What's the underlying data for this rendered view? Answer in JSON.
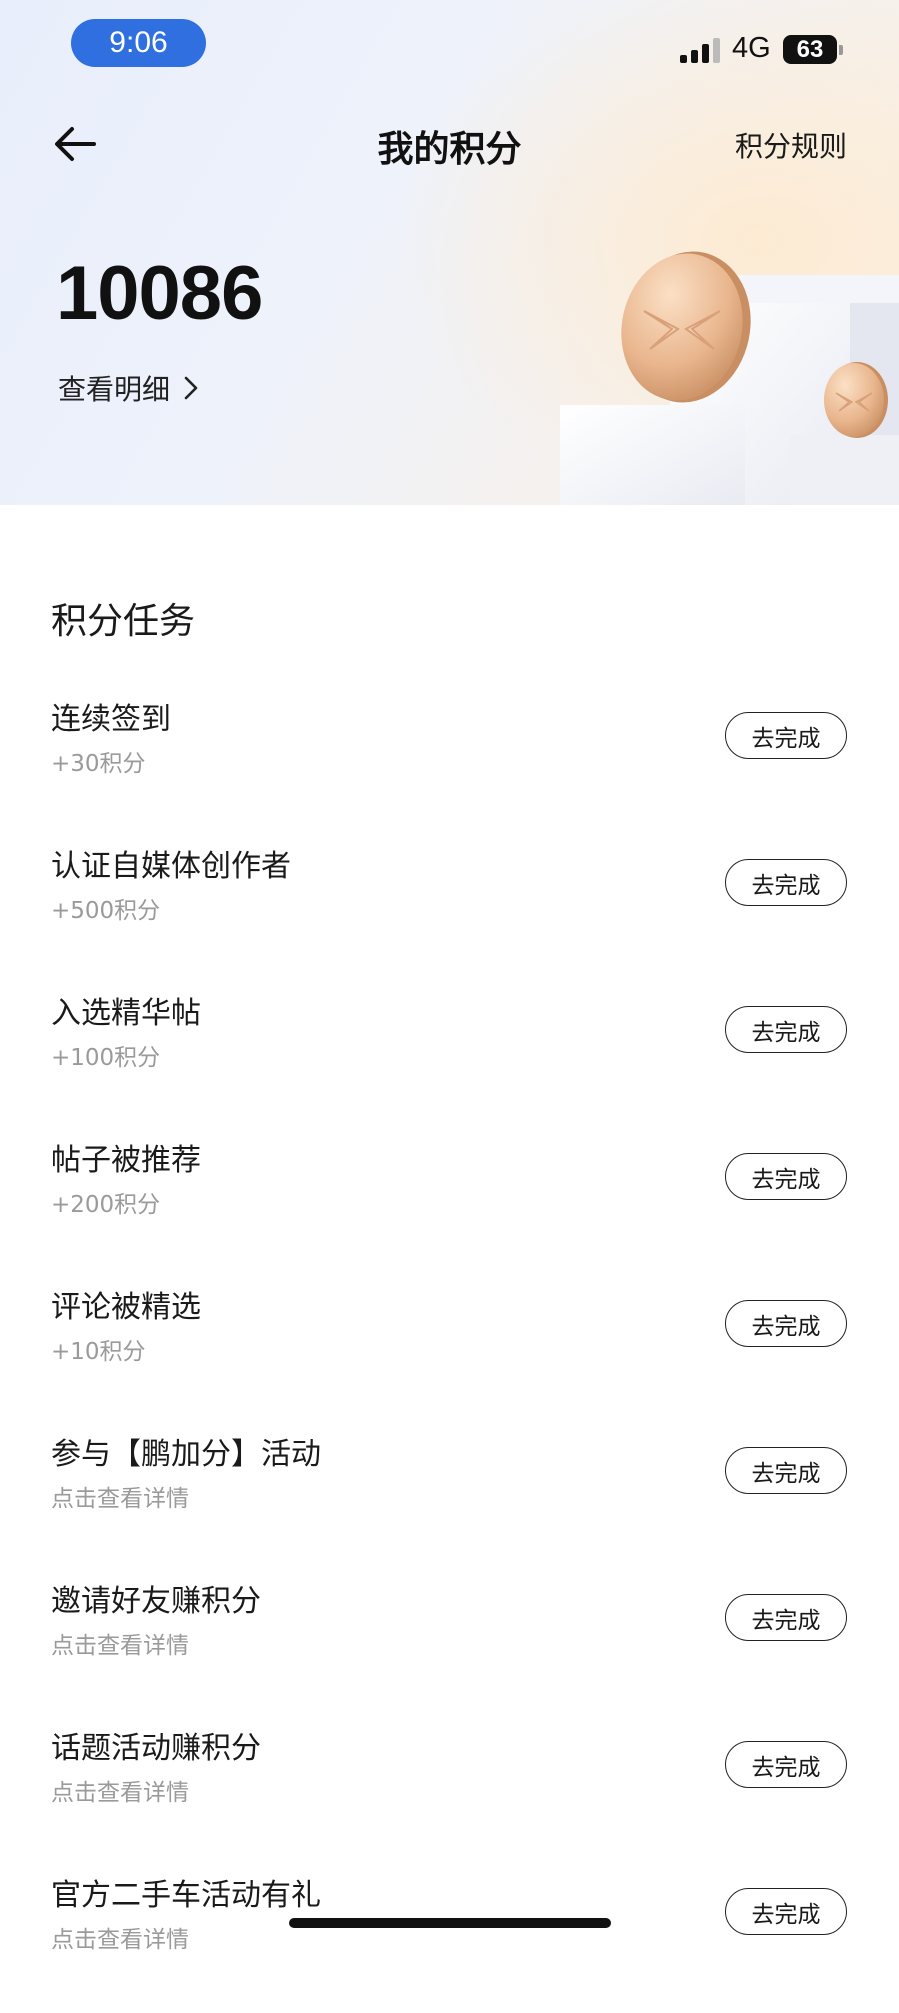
{
  "status_bar": {
    "time": "9:06",
    "network": "4G",
    "battery": "63"
  },
  "nav": {
    "title": "我的积分",
    "rules_label": "积分规则"
  },
  "points": {
    "value": "10086",
    "detail_label": "查看明细"
  },
  "tasks": {
    "section_title": "积分任务",
    "button_label": "去完成",
    "items": [
      {
        "title": "连续签到",
        "subtitle": "+30积分"
      },
      {
        "title": "认证自媒体创作者",
        "subtitle": "+500积分"
      },
      {
        "title": "入选精华帖",
        "subtitle": "+100积分"
      },
      {
        "title": "帖子被推荐",
        "subtitle": "+200积分"
      },
      {
        "title": "评论被精选",
        "subtitle": "+10积分"
      },
      {
        "title": "参与【鹏加分】活动",
        "subtitle": "点击查看详情"
      },
      {
        "title": "邀请好友赚积分",
        "subtitle": "点击查看详情"
      },
      {
        "title": "话题活动赚积分",
        "subtitle": "点击查看详情"
      },
      {
        "title": "官方二手车活动有礼",
        "subtitle": "点击查看详情"
      }
    ]
  },
  "colors": {
    "accent": "#2f6fe0",
    "coin": "#e6b58e",
    "muted_text": "#9a9a9a"
  }
}
